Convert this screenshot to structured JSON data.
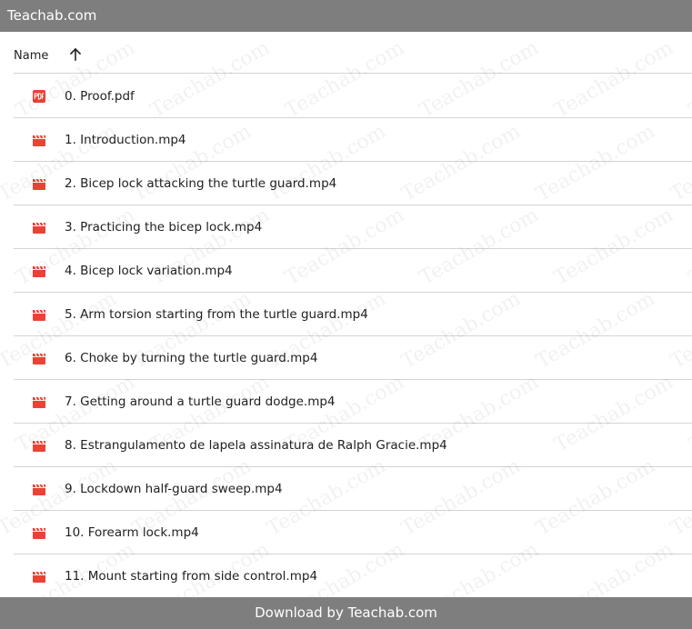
{
  "header": {
    "title": "Teachab.com"
  },
  "list_header": {
    "name_label": "Name",
    "sort_icon": "arrow-up-icon"
  },
  "files": [
    {
      "name": "0. Proof.pdf",
      "type": "pdf",
      "icon": "pdf-icon",
      "color": "#ea4335"
    },
    {
      "name": "1. Introduction.mp4",
      "type": "video",
      "icon": "video-icon",
      "color": "#ea4335"
    },
    {
      "name": "2. Bicep lock attacking the turtle guard.mp4",
      "type": "video",
      "icon": "video-icon",
      "color": "#ea4335"
    },
    {
      "name": "3. Practicing the bicep lock.mp4",
      "type": "video",
      "icon": "video-icon",
      "color": "#ea4335"
    },
    {
      "name": "4. Bicep lock variation.mp4",
      "type": "video",
      "icon": "video-icon",
      "color": "#ea4335"
    },
    {
      "name": "5. Arm torsion starting from the turtle guard.mp4",
      "type": "video",
      "icon": "video-icon",
      "color": "#ea4335"
    },
    {
      "name": "6. Choke by turning the turtle guard.mp4",
      "type": "video",
      "icon": "video-icon",
      "color": "#ea4335"
    },
    {
      "name": "7. Getting around a turtle guard dodge.mp4",
      "type": "video",
      "icon": "video-icon",
      "color": "#ea4335"
    },
    {
      "name": "8. Estrangulamento de lapela assinatura de Ralph Gracie.mp4",
      "type": "video",
      "icon": "video-icon",
      "color": "#ea4335"
    },
    {
      "name": "9. Lockdown half-guard sweep.mp4",
      "type": "video",
      "icon": "video-icon",
      "color": "#ea4335"
    },
    {
      "name": "10. Forearm lock.mp4",
      "type": "video",
      "icon": "video-icon",
      "color": "#ea4335"
    },
    {
      "name": "11. Mount starting from side control.mp4",
      "type": "video",
      "icon": "video-icon",
      "color": "#ea4335"
    }
  ],
  "footer": {
    "text": "Download by Teachab.com"
  },
  "watermark": {
    "text": "Teachab.com"
  }
}
